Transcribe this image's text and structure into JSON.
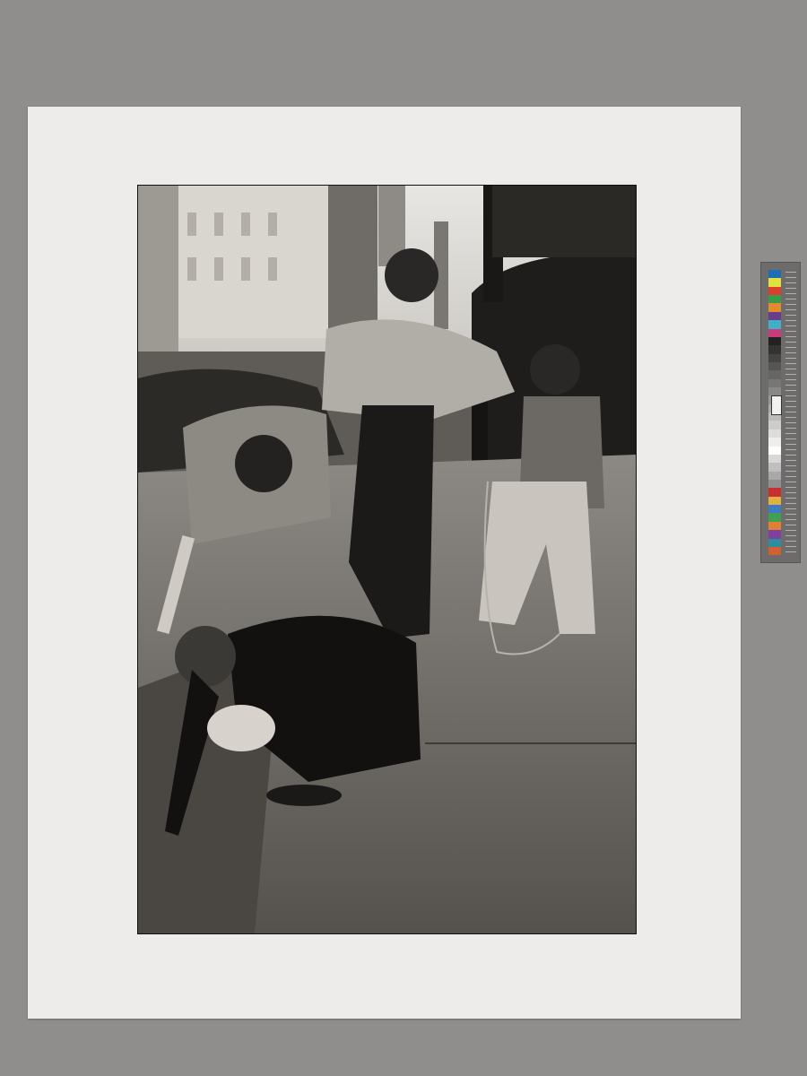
{
  "scene": {
    "mat_color": "#eeecea",
    "background_color": "#8f8e8c",
    "photo": {
      "subject": "street-scene-children-mailbox",
      "tone": "black-and-white"
    }
  },
  "color_card": {
    "patches": [
      "#1e6eb5",
      "#e0e040",
      "#d8402c",
      "#3c9a4a",
      "#e28a2c",
      "#6a3c8c",
      "#3fb0c8",
      "#c83c7c",
      "#222222",
      "#333333",
      "#444444",
      "#555555",
      "#666666",
      "#777777",
      "#888888",
      "#999999",
      "#aaaaaa",
      "#bbbbbb",
      "#cccccc",
      "#dddddd",
      "#eeeeee",
      "#ffffff",
      "#d8d8d8",
      "#c0c0c0",
      "#a8a8a8",
      "#909090",
      "#c83030",
      "#e0b040",
      "#3c7ac8",
      "#40a050",
      "#e08030",
      "#8040a0",
      "#2c8ca0",
      "#d06030"
    ]
  }
}
